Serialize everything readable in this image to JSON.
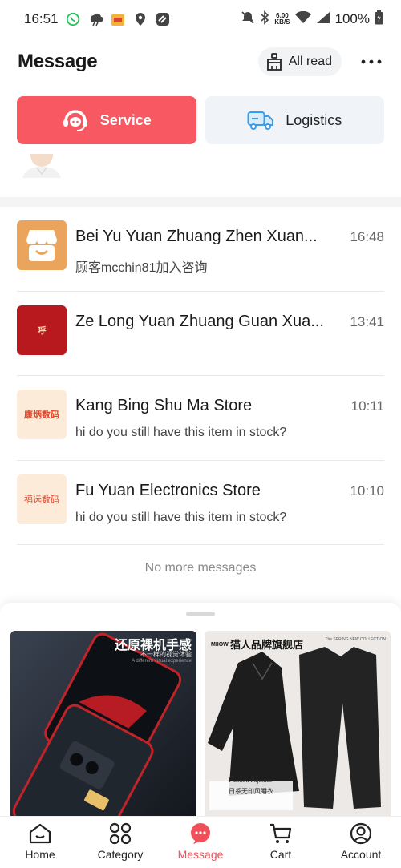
{
  "status_bar": {
    "time": "16:51",
    "net_speed_value": "6.00",
    "net_speed_unit": "KB/S",
    "battery": "100%"
  },
  "header": {
    "title": "Message",
    "all_read_label": "All read"
  },
  "tabs": [
    {
      "label": "Service",
      "active": true
    },
    {
      "label": "Logistics",
      "active": false
    }
  ],
  "messages": [
    {
      "name": "Bei Yu Yuan Zhuang Zhen Xuan...",
      "time": "16:48",
      "preview": "顾客mcchin81加入咨询",
      "avatar_text": "",
      "avatar_color": "#e9a35a"
    },
    {
      "name": "Ze Long Yuan Zhuang Guan Xua...",
      "time": "13:41",
      "preview": "",
      "avatar_text": "呼",
      "avatar_color": "#b8191e"
    },
    {
      "name": "Kang Bing Shu Ma Store",
      "time": "10:11",
      "preview": "hi do you still have this item in stock?",
      "avatar_text": "康炳数码",
      "avatar_color": "#fdebd9"
    },
    {
      "name": "Fu Yuan Electronics Store",
      "time": "10:10",
      "preview": "hi do you still have this item in stock?",
      "avatar_text": "福远数码",
      "avatar_color": "#fdebd9"
    }
  ],
  "footer_note": "No more messages",
  "recommendations": [
    {
      "headline": "还原裸机手感",
      "subline": "不一样的视觉体验",
      "subline2": "A different visual experience",
      "footer_text": "",
      "badge": "",
      "caption": "",
      "caption2": ""
    },
    {
      "headline": "猫人品牌旗舰店",
      "subline": "The SPRING NEW COLLECTION",
      "subline2": "",
      "footer_text": "",
      "badge": "MIIOW",
      "caption": "Fashion Pajamas",
      "caption2": "日系无印风睡衣"
    }
  ],
  "bottom_nav": [
    {
      "label": "Home",
      "icon": "home-icon",
      "active": false
    },
    {
      "label": "Category",
      "icon": "category-icon",
      "active": false
    },
    {
      "label": "Message",
      "icon": "message-icon",
      "active": true
    },
    {
      "label": "Cart",
      "icon": "cart-icon",
      "active": false
    },
    {
      "label": "Account",
      "icon": "account-icon",
      "active": false
    }
  ],
  "colors": {
    "accent": "#f75862",
    "tab_inactive_bg": "#f0f4f9",
    "nav_active": "#f0505a"
  }
}
